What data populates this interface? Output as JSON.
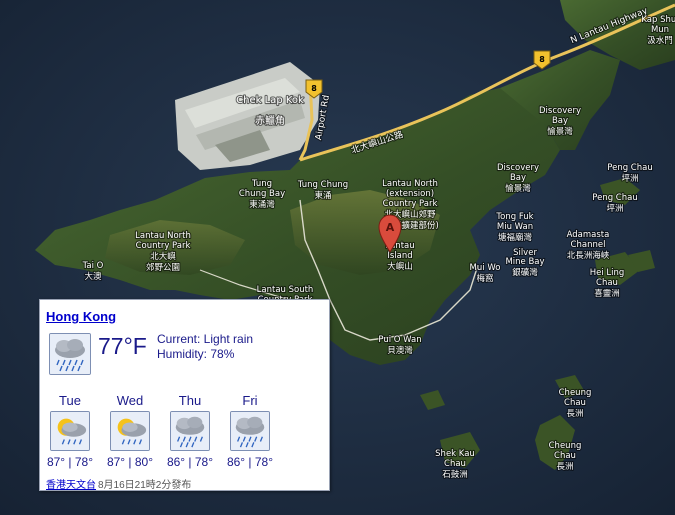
{
  "map": {
    "labels": {
      "chek_lap_kok_en": "Chek Lap Kok",
      "chek_lap_kok_zh": "赤鱲角",
      "airport_rd": "Airport Rd",
      "lantau_hwy": "N Lantau Highway",
      "north_lantau_road_zh": "北大嶼山公路",
      "route_8_a": "8",
      "route_8_b": "8",
      "kap_shui_mun_en_1": "Kap Shui",
      "kap_shui_mun_en_2": "Mun",
      "kap_shui_mun_zh": "汲水門",
      "discovery_bay_1_en_1": "Discovery",
      "discovery_bay_1_en_2": "Bay",
      "discovery_bay_1_zh": "愉景灣",
      "discovery_bay_2_en_1": "Discovery",
      "discovery_bay_2_en_2": "Bay",
      "discovery_bay_2_zh": "愉景灣",
      "tung_chung_bay_en_1": "Tung",
      "tung_chung_bay_en_2": "Chung Bay",
      "tung_chung_bay_zh": "東涌灣",
      "tung_chung_en": "Tung Chung",
      "tung_chung_zh": "東涌",
      "lantau_north_ext_1": "Lantau North",
      "lantau_north_ext_2": "(extension)",
      "lantau_north_ext_3": "Country Park",
      "lantau_north_ext_zh_1": "北大嶼山郊野",
      "lantau_north_ext_zh_2": "公園(擴建部份)",
      "peng_chau_en": "Peng Chau",
      "peng_chau_zh": "坪洲",
      "peng_chau_2_en": "Peng Chau",
      "peng_chau_2_zh": "坪洲",
      "tong_fuk_1": "Tong Fuk",
      "tong_fuk_2": "Miu Wan",
      "tong_fuk_zh": "塘福廟灣",
      "adamasta_1": "Adamasta",
      "adamasta_2": "Channel",
      "adamasta_zh": "北長洲海峽",
      "lantau_north_cp_1": "Lantau North",
      "lantau_north_cp_2": "Country Park",
      "lantau_north_cp_zh": "北大嶼",
      "lantau_north_cp_zh_2": "郊野公園",
      "lantau_island_en_1": "Lantau",
      "lantau_island_en_2": "Island",
      "lantau_island_zh": "大嶼山",
      "silver_mine_bay_1": "Silver",
      "silver_mine_bay_2": "Mine Bay",
      "silver_mine_bay_zh": "銀礦灣",
      "mui_wo_en": "Mui Wo",
      "mui_wo_zh": "梅窩",
      "hei_ling_chau_1": "Hei Ling",
      "hei_ling_chau_2": "Chau",
      "hei_ling_chau_zh": "喜靈洲",
      "tai_o_en": "Tai O",
      "tai_o_zh": "大澳",
      "lantau_south_1": "Lantau South",
      "lantau_south_2": "Country Park",
      "pui_o_wan_en": "Pui O Wan",
      "pui_o_wan_zh": "貝澳灣",
      "cheung_chau_en_1": "Cheung",
      "cheung_chau_en_2": "Chau",
      "cheung_chau_zh": "長洲",
      "shek_kwu_chau_1": "Shek Kau",
      "shek_kwu_chau_2": "Chau",
      "shek_kwu_chau_zh": "石鼓洲",
      "cheung_chau_2_1": "Cheung",
      "cheung_chau_2_2": "Chau",
      "cheung_chau_2_zh": "長洲",
      "marker_letter": "A"
    }
  },
  "weather": {
    "city": "Hong Kong",
    "current": {
      "temp": "77°F",
      "condition": "Current: Light rain",
      "humidity": "Humidity: 78%",
      "icon": "rain-cloud-icon"
    },
    "forecast": [
      {
        "day": "Tue",
        "temps": "87° | 78°",
        "icon": "partly-cloudy-rain-icon"
      },
      {
        "day": "Wed",
        "temps": "87° | 80°",
        "icon": "partly-cloudy-rain-icon"
      },
      {
        "day": "Thu",
        "temps": "86° | 78°",
        "icon": "rain-cloud-icon"
      },
      {
        "day": "Fri",
        "temps": "86° | 78°",
        "icon": "rain-cloud-icon"
      }
    ],
    "source": "香港天文台",
    "issued": "8月16日21時2分發布"
  },
  "colors": {
    "sea": "#1c2a3d",
    "land": "#3d5a2a",
    "link": "#0000cc",
    "text": "#1a1a8a",
    "road": "#e9c35a",
    "marker": "#d94b3c"
  }
}
